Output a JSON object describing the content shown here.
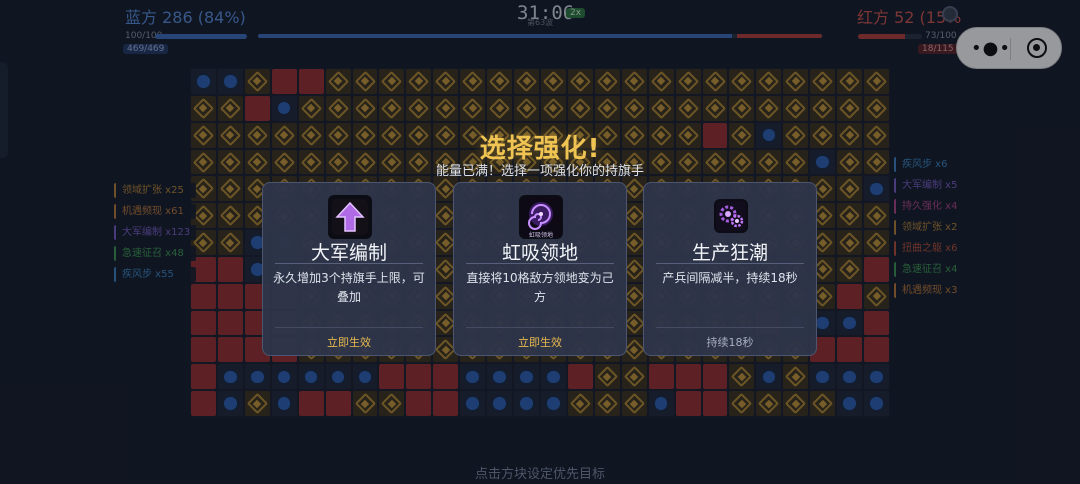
{
  "hud": {
    "blue_label": "蓝方 286 (84%)",
    "blue_hp": "100/100",
    "blue_count": "469/469",
    "red_label": "红方 52 (15%",
    "red_hp": "73/100",
    "red_count": "18/115",
    "timer": "31:06",
    "speed": "2x",
    "round": "第63波",
    "blue_share": 0.84,
    "red_share": 0.15,
    "blue_hp_fill": 1.0,
    "red_hp_fill": 0.73
  },
  "left_buffs": [
    {
      "label": "领域扩张 x25",
      "color": "#b8843a"
    },
    {
      "label": "机遇频现 x61",
      "color": "#c07a3c"
    },
    {
      "label": "大军编制 x123",
      "color": "#7a5ec8"
    },
    {
      "label": "急速征召 x48",
      "color": "#3f9a55"
    },
    {
      "label": "疾风步 x55",
      "color": "#3d86c8"
    }
  ],
  "right_buffs": [
    {
      "label": "疾风步 x6",
      "color": "#3d86c8"
    },
    {
      "label": "大军编制 x5",
      "color": "#7a5ec8"
    },
    {
      "label": "持久强化 x4",
      "color": "#b0458a"
    },
    {
      "label": "领域扩张 x2",
      "color": "#b8843a"
    },
    {
      "label": "扭曲之躯 x6",
      "color": "#b8503a"
    },
    {
      "label": "急速征召 x4",
      "color": "#3f9a55"
    },
    {
      "label": "机遇频现 x3",
      "color": "#c07a3c"
    }
  ],
  "modal": {
    "title": "选择强化!",
    "subtitle": "能量已满！选择一项强化你的持旗手"
  },
  "cards": [
    {
      "icon": "arrow-up-icon",
      "name": "大军编制",
      "desc": "永久增加3个持旗手上限，可叠加",
      "foot": "立即生效",
      "foot_color": "#e8b84e"
    },
    {
      "icon": "vortex-icon",
      "icon_caption": "虹吸领地",
      "name": "虹吸领地",
      "desc": "直接将10格敌方领地变为己方",
      "foot": "立即生效",
      "foot_color": "#e8b84e"
    },
    {
      "icon": "gears-icon",
      "name": "生产狂潮",
      "desc": "产兵间隔减半，持续18秒",
      "foot": "持续18秒",
      "foot_color": "#a9b0c2"
    }
  ],
  "hint": "点击方块设定优先目标",
  "board": {
    "rows": [
      "bbnrrnnnnnnnnnnnnnnnnnnnnn",
      "nnrbnnnnnnnnnnnnnnnnnnnnnn",
      "nnnnnnnnnnnnnnnnnnnrnbnnnn",
      "nnnnnnnnnnnnnnnnnnnnnnnbnn",
      "nnnnnnnnnnnnnnnnnnnnnnnnnb",
      "nnnnnnnnnnnnnnnnnnnnnnnnnn",
      "nnbbnnnnnnnnnnnnnnnnnnnnnn",
      "rrbbnnnnnnnnnnnnnnnnnnnnnr",
      "rrrrnnnnnnnnnnnnnnnnnnnnrn",
      "rrrrnnnnnnnnnnnnnnnnnrbbbr",
      "rrrrnnnnnnnnnnnnnnnnnnnrrr",
      "rbbbbbbrrrbbbbrnnrrrnbnbbb",
      "rbnbrrnnrrbbbbnnnbrrnnnnbb"
    ]
  }
}
